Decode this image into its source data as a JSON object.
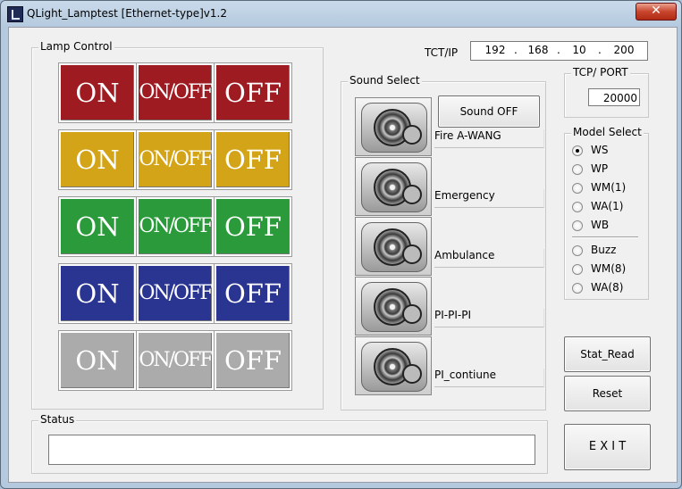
{
  "window": {
    "title": "QLight_Lamptest [Ethernet-type]v1.2",
    "close_symbol": "✕"
  },
  "lamp_control": {
    "legend": "Lamp Control",
    "rows": [
      {
        "color": "#9e1b22",
        "on": "ON",
        "onoff": "ON/OFF",
        "off": "OFF"
      },
      {
        "color": "#d4a418",
        "on": "ON",
        "onoff": "ON/OFF",
        "off": "OFF"
      },
      {
        "color": "#2a9a3a",
        "on": "ON",
        "onoff": "ON/OFF",
        "off": "OFF"
      },
      {
        "color": "#2a3592",
        "on": "ON",
        "onoff": "ON/OFF",
        "off": "OFF"
      },
      {
        "color": "#ababab",
        "on": "ON",
        "onoff": "ON/OFF",
        "off": "OFF"
      }
    ]
  },
  "network": {
    "ip_label": "TCT/IP",
    "ip": [
      "192",
      "168",
      "10",
      "200"
    ],
    "port_legend": "TCP/ PORT",
    "port": "20000"
  },
  "sound_select": {
    "legend": "Sound Select",
    "sound_off_label": "Sound OFF",
    "items": [
      "Fire A-WANG",
      "Emergency",
      "Ambulance",
      "PI-PI-PI",
      "PI_contiune"
    ]
  },
  "model_select": {
    "legend": "Model Select",
    "options": [
      "WS",
      "WP",
      "WM(1)",
      "WA(1)",
      "WB"
    ],
    "options2": [
      "Buzz",
      "WM(8)",
      "WA(8)"
    ],
    "selected": "WS"
  },
  "buttons": {
    "stat_read": "Stat_Read",
    "reset": "Reset",
    "exit": "E X I T"
  },
  "status": {
    "legend": "Status",
    "value": ""
  }
}
